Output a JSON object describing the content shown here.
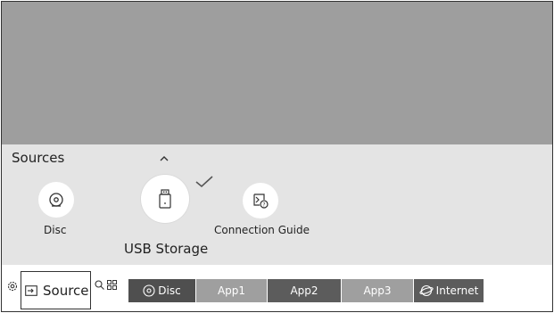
{
  "sources_panel": {
    "title": "Sources",
    "items": [
      {
        "label": "Disc",
        "icon": "disc-icon"
      },
      {
        "label": "USB Storage",
        "icon": "usb-storage-icon",
        "selected": true
      },
      {
        "label": "Connection Guide",
        "icon": "connection-guide-icon"
      }
    ]
  },
  "bottom_bar": {
    "source_label": "Source",
    "tiles": [
      {
        "label": "Disc",
        "icon": "disc-icon"
      },
      {
        "label": "App1"
      },
      {
        "label": "App2"
      },
      {
        "label": "App3"
      },
      {
        "label": "Internet",
        "icon": "internet-icon"
      }
    ]
  },
  "colors": {
    "preview_bg": "#9e9e9e",
    "panel_bg": "#e4e4e4",
    "tile_dark": "#4f4f4f",
    "tile_light": "#9f9f9f"
  }
}
